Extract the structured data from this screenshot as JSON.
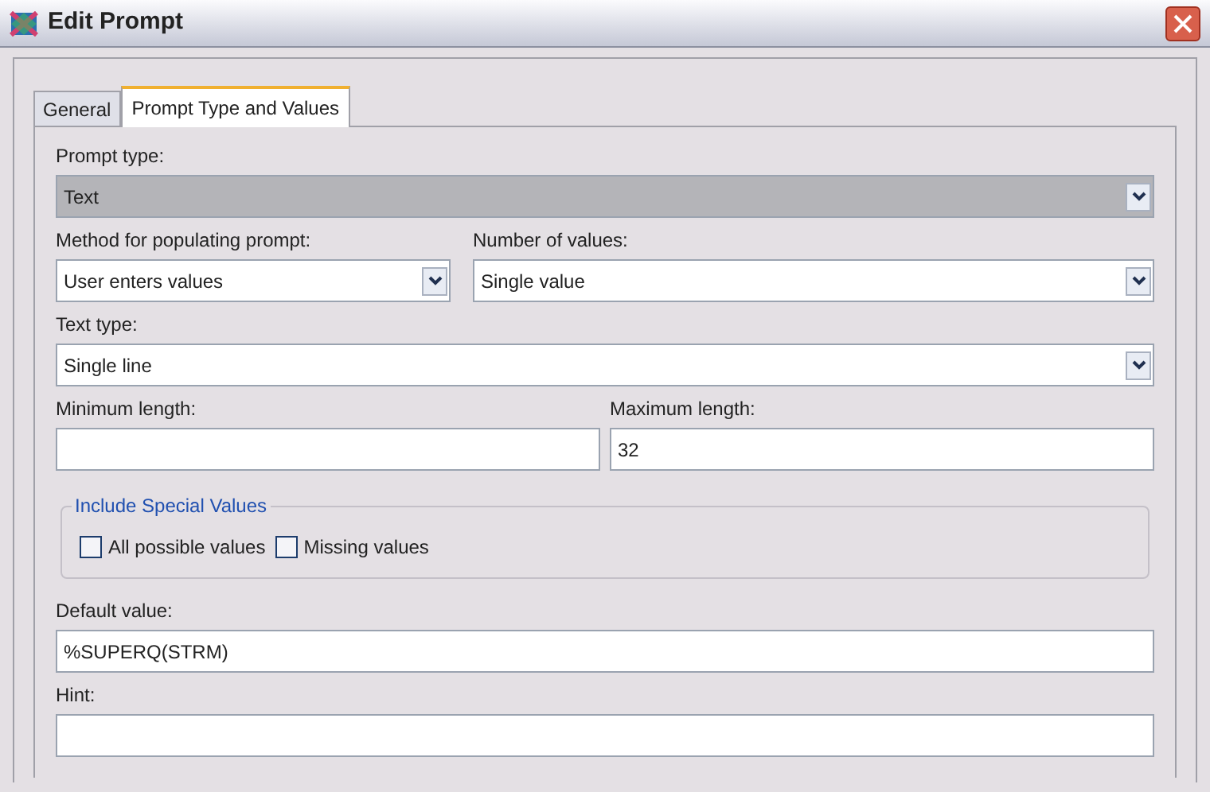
{
  "window": {
    "title": "Edit Prompt"
  },
  "tabs": [
    {
      "label": "General",
      "selected": false
    },
    {
      "label": "Prompt Type and Values",
      "selected": true
    }
  ],
  "prompt_type": {
    "label": "Prompt type:",
    "value": "Text",
    "disabled": true
  },
  "method": {
    "label": "Method for populating prompt:",
    "value": "User enters values"
  },
  "number_of_values": {
    "label": "Number of values:",
    "value": "Single value"
  },
  "text_type": {
    "label": "Text type:",
    "value": "Single line"
  },
  "minimum_length": {
    "label": "Minimum length:"
  },
  "maximum_length": {
    "label": "Maximum length:",
    "value": "32"
  },
  "special_values": {
    "title": "Include Special Values",
    "options": [
      {
        "label": "All possible values",
        "checked": false
      },
      {
        "label": "Missing values",
        "checked": false
      }
    ]
  },
  "default_value": {
    "label": "Default value:",
    "value": "%SUPERQ(STRM)"
  },
  "hint": {
    "label": "Hint:"
  }
}
